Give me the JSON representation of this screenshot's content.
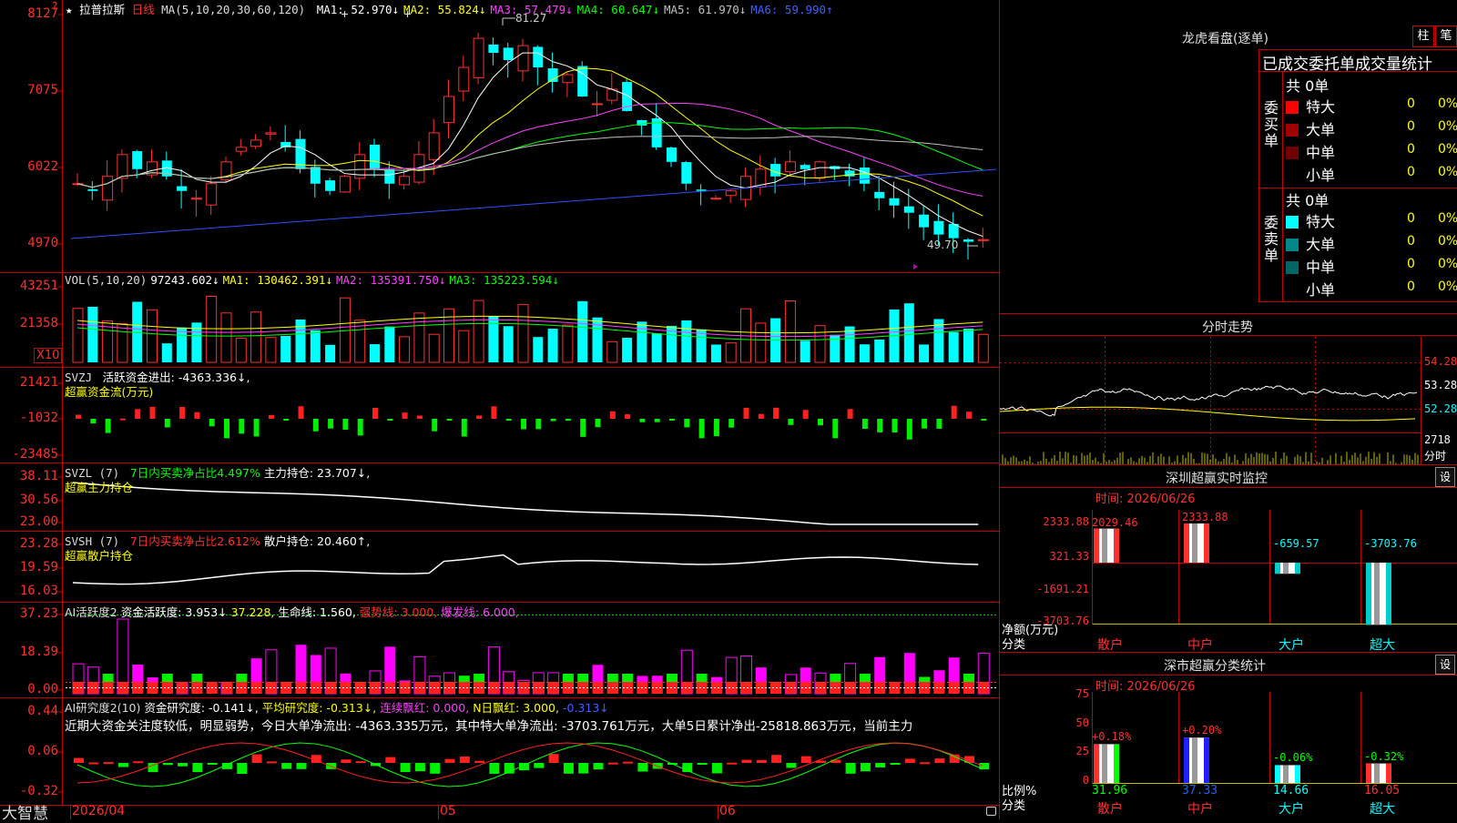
{
  "stock": {
    "star": "★",
    "name": "拉普拉斯",
    "period": "日线"
  },
  "ma_header": {
    "label": "MA(5,10,20,30,60,120)",
    "items": [
      {
        "name": "MA1:",
        "value": "52.970↓",
        "color": "#ffffff"
      },
      {
        "name": "MA2:",
        "value": "55.824↓",
        "color": "#ffff00"
      },
      {
        "name": "MA3:",
        "value": "57.479↓",
        "color": "#ff40ff"
      },
      {
        "name": "MA4:",
        "value": "60.647↓",
        "color": "#00ff00"
      },
      {
        "name": "MA5:",
        "value": "61.970↓",
        "color": "#c0c0c0"
      },
      {
        "name": "MA6:",
        "value": "59.990↑",
        "color": "#4060ff"
      }
    ]
  },
  "price_axis": [
    "8127",
    "7075",
    "6022",
    "4970"
  ],
  "price_marks": {
    "high": "81.27",
    "low": "49.70"
  },
  "vol_header": {
    "label": "VOL(5,10,20)",
    "v": "97243.602↓",
    "ma1": "MA1: 130462.391↓",
    "ma2": "MA2: 135391.750↓",
    "ma3": "MA3: 135223.594↓"
  },
  "vol_axis": [
    "43251",
    "21358"
  ],
  "vol_unit": "X10",
  "svzj": {
    "label": "SVZJ",
    "text": "活跃资金进出: -4363.336↓,",
    "sub": "超赢资金流(万元)",
    "axis": [
      "21421",
      "-1032",
      "-23485"
    ]
  },
  "svzl": {
    "label": "SVZL (7)",
    "t1": "7日内买卖净占比4.497%",
    "t2": "主力持仓: 23.707↓,",
    "sub": "超赢主力持仓",
    "axis": [
      "38.11",
      "30.56",
      "23.00"
    ]
  },
  "svsh": {
    "label": "SVSH (7)",
    "t1": "7日内买卖净占比2.612%",
    "t2": "散户持仓: 20.460↑,",
    "sub": "超赢散户持仓",
    "axis": [
      "23.28",
      "19.59",
      "16.03"
    ]
  },
  "ai1": {
    "label": "AI活跃度2",
    "t1": "资金活跃度: 3.953↓",
    "t2": "37.228,",
    "t3": "生命线: 1.560,",
    "t4": "强势线: 3.000,",
    "t5": "爆发线: 6.000,",
    "axis": [
      "37.23",
      "18.39",
      "0.00"
    ]
  },
  "ai2": {
    "label": "AI研究度2(10)",
    "t1": "资金研究度: -0.141↓,",
    "t2": "平均研究度: -0.313↓,",
    "t3": "连续飘红: 0.000,",
    "t4": "N日飘红: 3.000,",
    "t5": "-0.313↓",
    "comment": "近期大资金关注度较低，明显弱势，今日大单净流出: -4363.335万元，其中特大单净流出: -3703.761万元，大单5日累计净出-25818.863万元，当前主力",
    "axis": [
      "0.44",
      "0.06",
      "-0.32"
    ]
  },
  "date_axis": [
    "2026/04",
    "05",
    "06"
  ],
  "brand": "大智慧",
  "right": {
    "lhb_title": "龙虎看盘(逐单)",
    "btn1": "柱",
    "btn2": "笔",
    "ob_title": "已成交委托单成交量统计",
    "buy_label": "委买单",
    "sell_label": "委卖单",
    "buy_total": "共 0单",
    "sell_total": "共 0单",
    "buy_rows": [
      {
        "name": "特大",
        "v": "0",
        "p": "0%",
        "color": "#ff0000"
      },
      {
        "name": "大单",
        "v": "0",
        "p": "0%",
        "color": "#a00000"
      },
      {
        "name": "中单",
        "v": "0",
        "p": "0%",
        "color": "#700000"
      },
      {
        "name": "小单",
        "v": "0",
        "p": "0%",
        "color": "#000000"
      }
    ],
    "sell_rows": [
      {
        "name": "特大",
        "v": "0",
        "p": "0%",
        "color": "#00ffff"
      },
      {
        "name": "大单",
        "v": "0",
        "p": "0%",
        "color": "#008888"
      },
      {
        "name": "中单",
        "v": "0",
        "p": "0%",
        "color": "#006666"
      },
      {
        "name": "小单",
        "v": "0",
        "p": "0%",
        "color": "#000000"
      }
    ],
    "intraday_title": "分时走势",
    "intraday_axis": [
      "54.28",
      "53.28",
      "52.28",
      "2718",
      "分时"
    ],
    "sz_title": "深圳超赢实时监控",
    "sz_time": "时间: 2026/06/26",
    "sz_axis": [
      "2333.88",
      "321.33",
      "-1691.21",
      "-3703.76"
    ],
    "sz_left": [
      "净额(万元)",
      "分类"
    ],
    "sz_bars": [
      {
        "cat": "散户",
        "v": "2029.46",
        "value": 2029.46
      },
      {
        "cat": "中户",
        "v": "2333.88",
        "value": 2333.88
      },
      {
        "cat": "大户",
        "v": "-659.57",
        "value": -659.57
      },
      {
        "cat": "超大",
        "v": "-3703.76",
        "value": -3703.76
      }
    ],
    "cls_title": "深市超赢分类统计",
    "cls_time": "时间: 2026/06/26",
    "cls_axis": [
      "75",
      "50",
      "25",
      "0"
    ],
    "cls_left": [
      "比例%",
      "分类"
    ],
    "cls_bars": [
      {
        "cat": "散户",
        "pct": "+0.18%",
        "v": "31.96",
        "value": 31.96
      },
      {
        "cat": "中户",
        "pct": "+0.20%",
        "v": "37.33",
        "value": 37.33
      },
      {
        "cat": "大户",
        "pct": "-0.06%",
        "v": "14.66",
        "value": 14.66
      },
      {
        "cat": "超大",
        "pct": "-0.32%",
        "v": "16.05",
        "value": 16.05
      }
    ],
    "gear": "设"
  }
}
